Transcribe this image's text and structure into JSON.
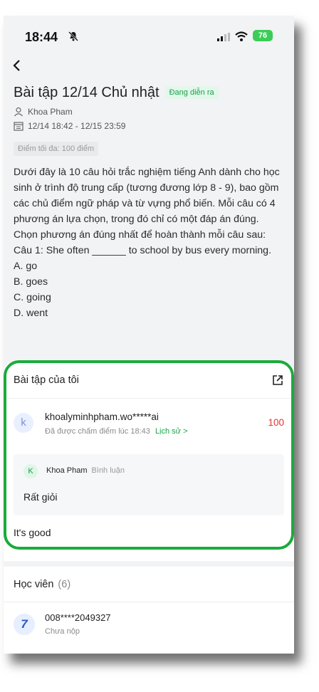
{
  "status_bar": {
    "time": "18:44",
    "battery": "76"
  },
  "header": {
    "title": "Bài tập 12/14 Chủ nhật",
    "status_tag": "Đang diễn ra",
    "author": "Khoa Pham",
    "date_range": "12/14 18:42 - 12/15 23:59",
    "max_score": "Điểm tối đa: 100 điểm"
  },
  "description": [
    "Dưới đây là 10 câu hỏi trắc nghiệm tiếng Anh dành cho học sinh ở trình độ trung cấp (tương đương lớp 8 - 9), bao gồm các chủ điểm ngữ pháp và từ vựng phổ biến. Mỗi câu có 4 phương án lựa chọn, trong đó chỉ có một đáp án đúng.",
    "Chọn phương án đúng nhất để hoàn thành mỗi câu sau:",
    "Câu 1: She often ______ to school by bus every morning.",
    "A. go",
    "B. goes",
    "C. going",
    "D. went"
  ],
  "my_assignment": {
    "title": "Bài tập của tôi",
    "avatar_letter": "k",
    "email": "khoalyminhpham.wo*****ai",
    "graded_info": "Đã được chấm điểm lúc 18:43",
    "history_label": "Lịch sử >",
    "score": "100",
    "comment": {
      "avatar_letter": "K",
      "author": "Khoa Pham",
      "role": "Bình luận",
      "text": "Rất giỏi"
    },
    "answer": "It's good"
  },
  "students": {
    "title": "Học viên",
    "count": "(6)",
    "items": [
      {
        "avatar_number": "7",
        "id": "008****2049327",
        "status": "Chưa nộp"
      }
    ]
  },
  "colors": {
    "accent_green": "#17a34a",
    "highlight_green": "#1aab3c",
    "score_red": "#e5322d"
  }
}
